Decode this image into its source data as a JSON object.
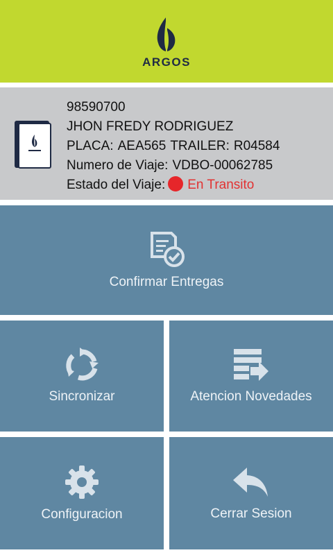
{
  "header": {
    "brand": "ARGOS"
  },
  "driver": {
    "id": "98590700",
    "name": "JHON FREDY RODRIGUEZ",
    "plate_label": "PLACA:",
    "plate": "AEA565",
    "trailer_label": "TRAILER:",
    "trailer": "R04584",
    "trip_label": "Numero de Viaje:",
    "trip": "VDBO-00062785",
    "status_label": "Estado del Viaje:",
    "status": "En Transito",
    "status_color": "#e6262a"
  },
  "menu": {
    "confirm": "Confirmar Entregas",
    "sync": "Sincronizar",
    "news": "Atencion Novedades",
    "config": "Configuracion",
    "logout": "Cerrar Sesion"
  },
  "colors": {
    "header_bg": "#c1d82f",
    "info_bg": "#c8c9cb",
    "tile_bg": "#5f87a2"
  }
}
